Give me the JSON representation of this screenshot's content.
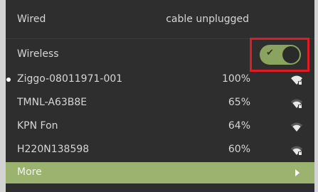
{
  "wired": {
    "label": "Wired",
    "status": "cable unplugged"
  },
  "wireless": {
    "label": "Wireless",
    "enabled": true,
    "toggle_check": "✔",
    "highlight_color": "#e01b24"
  },
  "networks": [
    {
      "name": "Ziggo-08011971-001",
      "signal": "100%",
      "active": true,
      "secured": true
    },
    {
      "name": "TMNL-A63B8E",
      "signal": "65%",
      "active": false,
      "secured": true
    },
    {
      "name": "KPN Fon",
      "signal": "64%",
      "active": false,
      "secured": false
    },
    {
      "name": "H220N138598",
      "signal": "60%",
      "active": false,
      "secured": true
    }
  ],
  "more": {
    "label": "More",
    "icon": "chevron-right-icon"
  },
  "colors": {
    "panel_bg": "#2e2e2e",
    "accent": "#9bb36e",
    "toggle_on": "#8aa460"
  }
}
